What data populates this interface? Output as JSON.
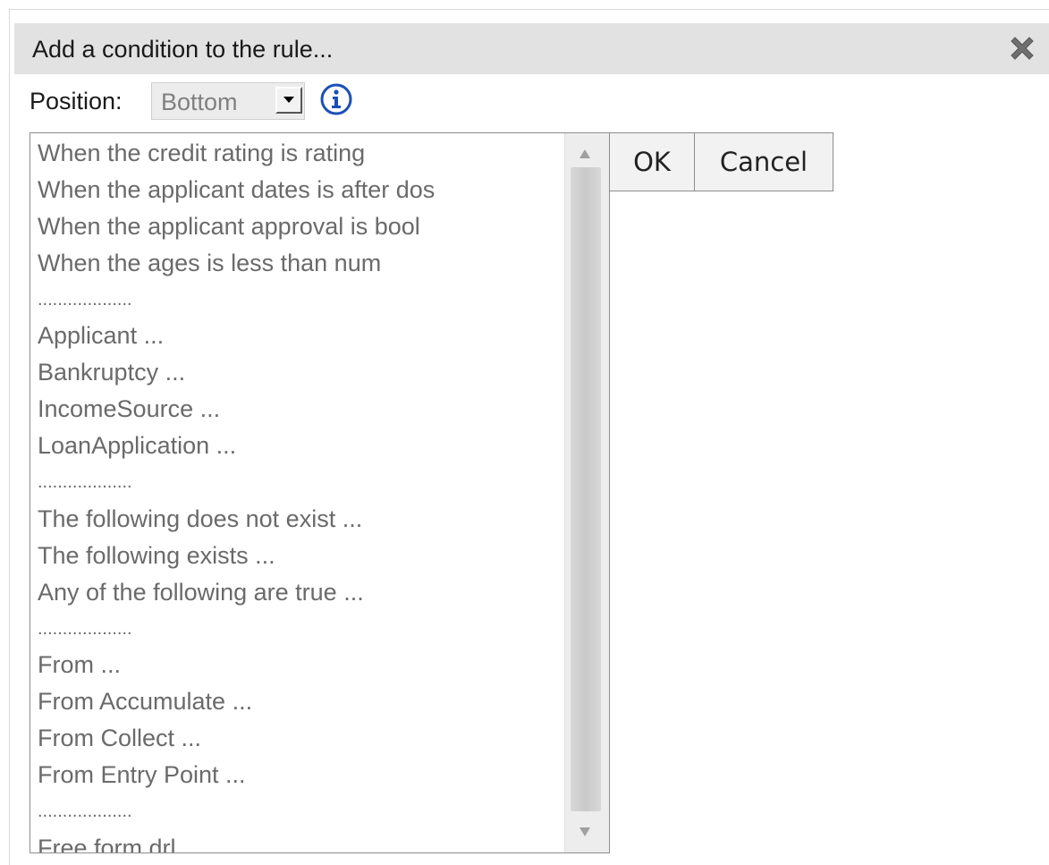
{
  "dialog": {
    "title": "Add a condition to the rule...",
    "close_icon": "close-x-icon"
  },
  "position": {
    "label": "Position:",
    "selected": "Bottom",
    "info_icon": "info-icon"
  },
  "list": {
    "items": [
      "When the credit rating is rating",
      "When the applicant dates is after dos",
      "When the applicant approval is bool",
      "When the ages is less than num",
      "...................",
      "Applicant ...",
      "Bankruptcy ...",
      "IncomeSource ...",
      "LoanApplication ...",
      "...................",
      "The following does not exist ...",
      "The following exists ...",
      "Any of the following are true ...",
      "...................",
      "From ...",
      "From Accumulate ...",
      "From Collect ...",
      "From Entry Point ...",
      "...................",
      "Free form drl"
    ]
  },
  "buttons": {
    "ok": "OK",
    "cancel": "Cancel"
  }
}
